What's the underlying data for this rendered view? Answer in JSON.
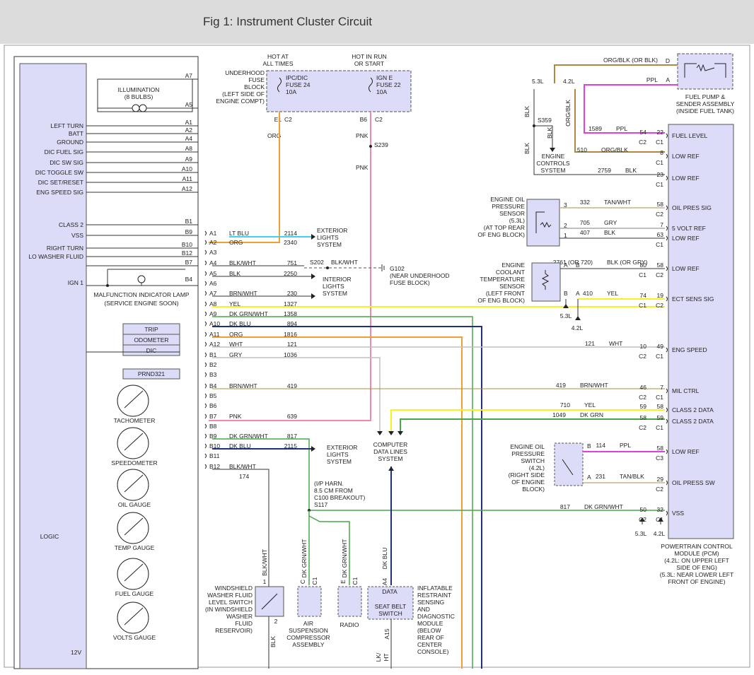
{
  "figure_title": "Fig 1: Instrument Cluster Circuit",
  "colors": {
    "module_fill": "#dcdcf8",
    "module_stroke": "#555555",
    "orange": "#f0a030",
    "pink": "#f08aa8",
    "cyan": "#40d0f0",
    "yellow": "#f8f020",
    "green": "#48a848",
    "navy": "#203080",
    "magenta": "#e040e0",
    "tan": "#c8b088",
    "brown": "#b08840",
    "gray": "#c0c0c0",
    "black": "#333333"
  },
  "cluster": {
    "pins_left": [
      {
        "label": "LEFT TURN",
        "pin": "A1"
      },
      {
        "label": "BATT",
        "pin": "A2"
      },
      {
        "label": "GROUND",
        "pin": "A4"
      },
      {
        "label": "DIC FUEL SIG",
        "pin": "A8"
      },
      {
        "label": "DIC SW SIG",
        "pin": "A9"
      },
      {
        "label": "DIC TOGGLE SW",
        "pin": "A10"
      },
      {
        "label": "DIC SET/RESET",
        "pin": "A11"
      },
      {
        "label": "ENG SPEED SIG",
        "pin": "A12"
      },
      {
        "label": "CLASS 2",
        "pin": "B1"
      },
      {
        "label": "VSS",
        "pin": "B9"
      },
      {
        "label": "RIGHT TURN",
        "pin": "B10"
      },
      {
        "label": "LO WASHER FLUID",
        "pin": "B12"
      },
      {
        "label": "",
        "pin": "B7"
      },
      {
        "label": "IGN 1",
        "pin": "B4"
      }
    ],
    "illum_pin_top": "A7",
    "illum_pin_bot": "A5",
    "illumination": "ILLUMINATION",
    "illumination_sub": "(8 BULBS)",
    "mil_1": "MALFUNCTION INDICATOR LAMP",
    "mil_2": "(SERVICE ENGINE SOON)",
    "dic": [
      "TRIP",
      "ODOMETER",
      "DIC"
    ],
    "prnd": "PRND321",
    "gauges": [
      "TACHOMETER",
      "SPEEDOMETER",
      "OIL GAUGE",
      "TEMP GAUGE",
      "FUEL GAUGE",
      "VOLTS GAUGE"
    ],
    "logic": "LOGIC",
    "bottom_label": "12V"
  },
  "fuse_block": {
    "hot1": "HOT AT",
    "hot2": "ALL TIMES",
    "run1": "HOT IN RUN",
    "run2": "OR START",
    "label": [
      "UNDERHOOD",
      "FUSE",
      "BLOCK",
      "(LEFT SIDE OF",
      "ENGINE COMPT)"
    ],
    "fuse1": [
      "IPC/DIC",
      "FUSE 24",
      "10A"
    ],
    "fuse2": [
      "IGN E",
      "FUSE 22",
      "10A"
    ],
    "e1": "E1",
    "c2a": "C2",
    "b6": "B6",
    "c2b": "C2",
    "org": "ORG",
    "pnk": "PNK",
    "s239": "S239",
    "pnk2": "PNK"
  },
  "connector_rows": [
    {
      "pin": "A1",
      "color": "LT BLU",
      "circuit": "2114"
    },
    {
      "pin": "A2",
      "color": "ORG",
      "circuit": "2340"
    },
    {
      "pin": "A3",
      "color": "",
      "circuit": ""
    },
    {
      "pin": "A4",
      "color": "BLK/WHT",
      "circuit": "751"
    },
    {
      "pin": "A5",
      "color": "BLK",
      "circuit": "2250"
    },
    {
      "pin": "A6",
      "color": "",
      "circuit": ""
    },
    {
      "pin": "A7",
      "color": "BRN/WHT",
      "circuit": "230"
    },
    {
      "pin": "A8",
      "color": "YEL",
      "circuit": "1327"
    },
    {
      "pin": "A9",
      "color": "DK GRN/WHT",
      "circuit": "1358"
    },
    {
      "pin": "A10",
      "color": "DK BLU",
      "circuit": "894"
    },
    {
      "pin": "A11",
      "color": "ORG",
      "circuit": "1816"
    },
    {
      "pin": "A12",
      "color": "WHT",
      "circuit": "121"
    },
    {
      "pin": "B1",
      "color": "GRY",
      "circuit": "1036"
    },
    {
      "pin": "B2",
      "color": "",
      "circuit": ""
    },
    {
      "pin": "B3",
      "color": "",
      "circuit": ""
    },
    {
      "pin": "B4",
      "color": "BRN/WHT",
      "circuit": "419"
    },
    {
      "pin": "B5",
      "color": "",
      "circuit": ""
    },
    {
      "pin": "B6",
      "color": "",
      "circuit": ""
    },
    {
      "pin": "B7",
      "color": "PNK",
      "circuit": "639"
    },
    {
      "pin": "B8",
      "color": "",
      "circuit": ""
    },
    {
      "pin": "B9",
      "color": "DK GRN/WHT",
      "circuit": "817"
    },
    {
      "pin": "B10",
      "color": "DK BLU",
      "circuit": "2115"
    },
    {
      "pin": "B11",
      "color": "",
      "circuit": ""
    },
    {
      "pin": "B12",
      "color": "BLK/WHT",
      "circuit": ""
    }
  ],
  "mid_labels": {
    "ext_lights_1": [
      "EXTERIOR",
      "LIGHTS",
      "SYSTEM"
    ],
    "s202": "S202",
    "blkwht": "BLK/WHT",
    "g102": "G102",
    "g102_note": [
      "(NEAR UNDERHOOD",
      "FUSE BLOCK)"
    ],
    "int_lights": [
      "INTERIOR",
      "LIGHTS",
      "SYSTEM"
    ],
    "ext_lights_2": [
      "EXTERIOR",
      "LIGHTS",
      "SYSTEM"
    ],
    "cdl": [
      "COMPUTER",
      "DATA LINES",
      "SYSTEM"
    ],
    "c174": "174",
    "harn": [
      "(I/P HARN.",
      "8.5 CM FROM",
      "C100 BREAKOUT)",
      "S117"
    ]
  },
  "bottom": {
    "washer_wire": "BLK/WHT",
    "washer_pin": "1",
    "washer_label": [
      "WINDSHIELD",
      "WASHER FLUID",
      "LEVEL SWITCH",
      "(IN WINDSHIELD",
      "WASHER",
      "FLUID",
      "RESERVOIR)"
    ],
    "washer_pin2": "2",
    "washer_blk": "BLK",
    "air_wire": "DK GRN/WHT",
    "air_pin": "C",
    "air_conn": "C1",
    "air_label": [
      "AIR",
      "SUSPENSION",
      "COMPRESSOR",
      "ASSEMBLY"
    ],
    "radio_wire": "DK GRN/WHT",
    "radio_pin": "E",
    "radio_conn": "C1",
    "radio_label": "RADIO",
    "data_wire": "DK BLU",
    "data_pin": "A4",
    "data_label": "DATA",
    "seat_label": [
      "SEAT BELT",
      "SWITCH"
    ],
    "a15": "A15",
    "sdm_label": [
      "INFLATABLE",
      "RESTRAINT",
      "SENSING",
      "AND",
      "DIAGNOSTIC",
      "MODULE",
      "(BELOW",
      "REAR OF",
      "CENTER",
      "CONSOLE)"
    ],
    "blk_frag": "LK/",
    "wht_frag": "HT"
  },
  "right": {
    "fuel_pump": [
      "FUEL PUMP &",
      "SENDER ASSEMBLY",
      "(INSIDE FUEL TANK)"
    ],
    "d": "D",
    "a": "A",
    "orgblk": "ORG/BLK (OR BLK)",
    "ppl": "PPL",
    "l53": "5.3L",
    "l42": "4.2L",
    "blk": "BLK",
    "orgblk_v": "ORG/BLK",
    "s359": "S359",
    "blk2": "BLK",
    "blk3": "BLK",
    "ecs": [
      "ENGINE",
      "CONTROLS",
      "SYSTEM"
    ],
    "pcm_label": [
      "POWERTRAIN CONTROL",
      "MODULE (PCM)",
      "(4.2L: ON UPPER LEFT",
      "SIDE OF ENG)",
      "(5.3L: NEAR LOWER LEFT",
      "FRONT OF ENGINE)"
    ],
    "pcm_pins": [
      {
        "label": "FUEL LEVEL",
        "circuit": "1589",
        "color": "PPL",
        "pin_a": "54",
        "pin_b": "22",
        "conn_a": "C2",
        "conn_b": "C1"
      },
      {
        "label": "LOW REF",
        "circuit": "510",
        "color": "ORG/BLK",
        "pin_a": "",
        "pin_b": "8",
        "conn_a": "",
        "conn_b": "C1"
      },
      {
        "label": "LOW REF",
        "circuit": "2759",
        "color": "BLK",
        "pin_a": "",
        "pin_b": "23",
        "conn_a": "",
        "conn_b": "C1"
      },
      {
        "label": "OIL PRES SIG",
        "circuit": "332",
        "color": "TAN/WHT",
        "pin_a": "",
        "pin_b": "58",
        "conn_a": "",
        "conn_b": "C2"
      },
      {
        "label": "5 VOLT REF",
        "circuit": "705",
        "color": "GRY",
        "pin_a": "",
        "pin_b": "7",
        "conn_a": "",
        "conn_b": ""
      },
      {
        "label": "LOW REF",
        "circuit": "407",
        "color": "BLK",
        "pin_a": "",
        "pin_b": "63",
        "conn_a": "",
        "conn_b": "C1"
      },
      {
        "label": "LOW REF",
        "circuit": "2761 (OR 720)",
        "color": "BLK (OR GRY)",
        "pin_a": "80",
        "pin_b": "58",
        "conn_a": "C1",
        "conn_b": "C2"
      },
      {
        "label": "ECT SENS SIG",
        "circuit": "410",
        "color": "YEL",
        "pin_a": "74",
        "pin_b": "19",
        "conn_a": "C1",
        "conn_b": "C2"
      },
      {
        "label": "ENG SPEED",
        "circuit": "121",
        "color": "WHT",
        "pin_a": "10",
        "pin_b": "49",
        "conn_a": "C2",
        "conn_b": "C1"
      },
      {
        "label": "MIL CTRL",
        "circuit": "419",
        "color": "BRN/WHT",
        "pin_a": "46",
        "pin_b": "7",
        "conn_a": "C2",
        "conn_b": "C1"
      },
      {
        "label": "CLASS 2 DATA",
        "circuit": "710",
        "color": "YEL",
        "pin_a": "59",
        "pin_b": "58",
        "conn_a": "",
        "conn_b": ""
      },
      {
        "label": "CLASS 2 DATA",
        "circuit": "1049",
        "color": "DK GRN",
        "pin_a": "58",
        "pin_b": "59",
        "conn_a": "C2",
        "conn_b": "C1"
      },
      {
        "label": "LOW REF",
        "circuit": "114",
        "color": "PPL",
        "pin_a": "",
        "pin_b": "58",
        "conn_a": "",
        "conn_b": "C3"
      },
      {
        "label": "OIL PRESS SW",
        "circuit": "231",
        "color": "TAN/BLK",
        "pin_a": "",
        "pin_b": "29",
        "conn_a": "",
        "conn_b": "C2"
      },
      {
        "label": "VSS",
        "circuit": "817",
        "color": "DK GRN/WHT",
        "pin_a": "50",
        "pin_b": "32",
        "conn_a": "C2",
        "conn_b": "C1"
      }
    ],
    "oil_sensor": [
      "ENGINE OIL",
      "PRESSURE",
      "SENSOR",
      "(5.3L)",
      "(AT TOP REAR",
      "OF ENG BLOCK)"
    ],
    "oil_pins": [
      "3",
      "2",
      "1"
    ],
    "ect_sensor": [
      "ENGINE",
      "COOLANT",
      "TEMPERATURE",
      "SENSOR",
      "(LEFT FRONT",
      "OF ENG BLOCK)"
    ],
    "ect_a": "A",
    "ect_b": "B",
    "ect_l53": "5.3L",
    "ect_l42": "4.2L",
    "oil_switch": [
      "ENGINE OIL",
      "PRESSURE",
      "SWITCH",
      "(4.2L)",
      "(RIGHT SIDE",
      "OF ENGINE",
      "BLOCK)"
    ],
    "sw_b": "B",
    "sw_a": "A",
    "vss_l53": "5.3L",
    "vss_l42": "4.2L"
  }
}
